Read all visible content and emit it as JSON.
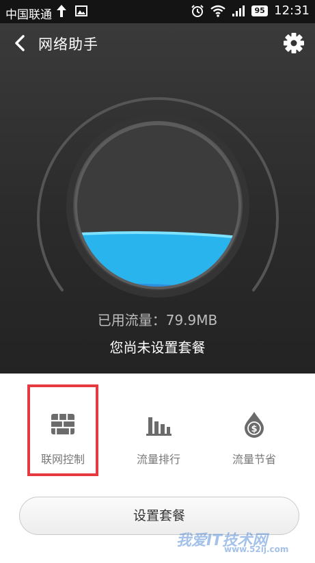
{
  "status_bar": {
    "carrier": "中国联通",
    "battery": "95",
    "time": "12:31",
    "icons": [
      "upload-arrow-icon",
      "image-icon",
      "alarm-icon",
      "wifi-icon",
      "signal-icon",
      "battery-icon"
    ]
  },
  "header": {
    "title": "网络助手",
    "back_icon": "chevron-left-icon",
    "settings_icon": "gear-icon"
  },
  "usage": {
    "used_label": "已用流量：79.9MB",
    "plan_note": "您尚未设置套餐"
  },
  "tools": [
    {
      "label": "联网控制",
      "icon": "firewall-icon"
    },
    {
      "label": "流量排行",
      "icon": "bar-chart-icon"
    },
    {
      "label": "流量节省",
      "icon": "money-drop-icon"
    }
  ],
  "setup_button": {
    "label": "设置套餐"
  },
  "watermark": {
    "text": "我爱IT技术网",
    "url": "www.52ij.com"
  },
  "colors": {
    "header_bg": "#2b2b2b",
    "water_light": "#2ab4ee",
    "water_dark": "#2d8fe0",
    "highlight": "#e53a40"
  }
}
